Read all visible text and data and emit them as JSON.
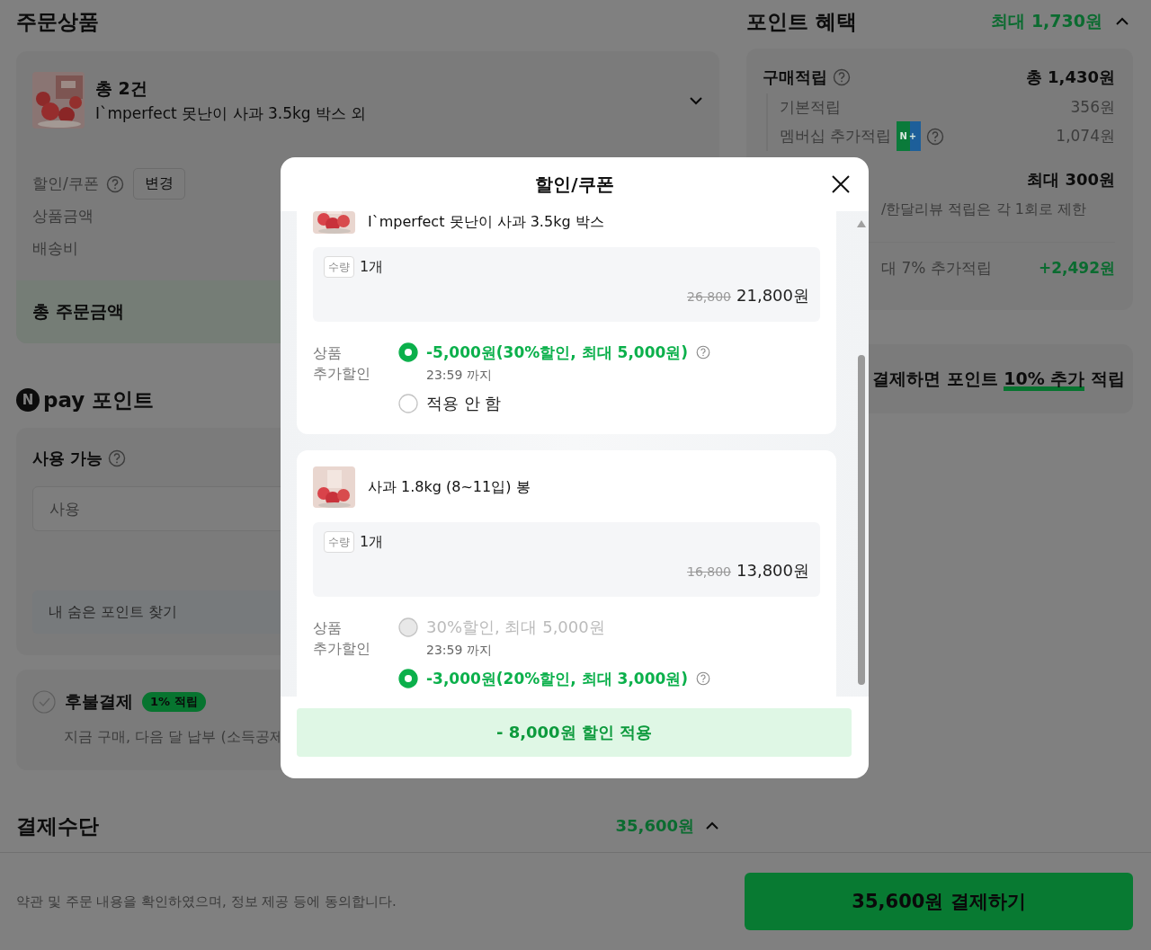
{
  "order_section": {
    "title": "주문상품",
    "summary": {
      "count": "총 2건",
      "name": "I`mperfect 못난이 사과 3.5kg 박스 외",
      "expanded": false
    },
    "coupon": {
      "label": "할인/쿠폰",
      "button": "변경"
    },
    "rows": [
      "상품금액",
      "배송비"
    ],
    "total_label": "총 주문금액"
  },
  "npay_points": {
    "logo": "N",
    "title": "pay 포인트",
    "available_label": "사용 가능",
    "input": {
      "placeholder": "사용"
    },
    "hidden_points_button": "내 숨은 포인트 찾기"
  },
  "deferred_payment": {
    "checked": false,
    "title": "후불결제",
    "badge": "1% 적립",
    "description": "지금 구매, 다음 달 납부 (소득공제"
  },
  "payment_method": {
    "title": "결제수단",
    "amount": "35,600원",
    "expanded": true
  },
  "points_benefit": {
    "title": "포인트 혜택",
    "total": "최대 1,730원",
    "expanded": true,
    "purchase": {
      "label": "구매적립",
      "total": "총 1,430원",
      "items": [
        {
          "label": "기본적립",
          "value": "356원"
        },
        {
          "label": "멤버십 추가적립",
          "badge": "N+",
          "value": "1,074원"
        }
      ]
    },
    "review": {
      "total": "최대 300원",
      "note": "/한달리뷰 적립은 각 1회로 제한"
    },
    "extra": {
      "label": "대 7% 추가적립",
      "value": "+2,492원"
    },
    "promo": {
      "before": "결제하면 포인트",
      "highlight": "10% 추가",
      "after": "적립"
    }
  },
  "footer": {
    "agreement": "약관 및 주문 내용을 확인하였으며, 정보 제공 등에 동의합니다.",
    "pay_button": "35,600원 결제하기"
  },
  "modal": {
    "title": "할인/쿠폰",
    "products": [
      {
        "name": "I`mperfect 못난이 사과 3.5kg 박스",
        "qty_label": "수량",
        "qty": "1개",
        "original_price": "26,800",
        "price": "21,800원",
        "discount_label": "상품 추가할인",
        "options": [
          {
            "text": "-5,000원(30%할인, 최대 5,000원)",
            "selected": true,
            "disabled": false,
            "help": true,
            "deadline": "23:59 까지"
          },
          {
            "text": "적용 안 함",
            "selected": false,
            "disabled": false,
            "help": false
          }
        ]
      },
      {
        "name": "사과 1.8kg (8~11입) 봉",
        "qty_label": "수량",
        "qty": "1개",
        "original_price": "16,800",
        "price": "13,800원",
        "discount_label": "상품 추가할인",
        "options": [
          {
            "text": "30%할인, 최대 5,000원",
            "selected": false,
            "disabled": true,
            "help": false,
            "deadline": "23:59 까지"
          },
          {
            "text": "-3,000원(20%할인, 최대 3,000원)",
            "selected": true,
            "disabled": false,
            "help": true
          }
        ]
      }
    ],
    "apply_button": "- 8,000원 할인 적용"
  }
}
